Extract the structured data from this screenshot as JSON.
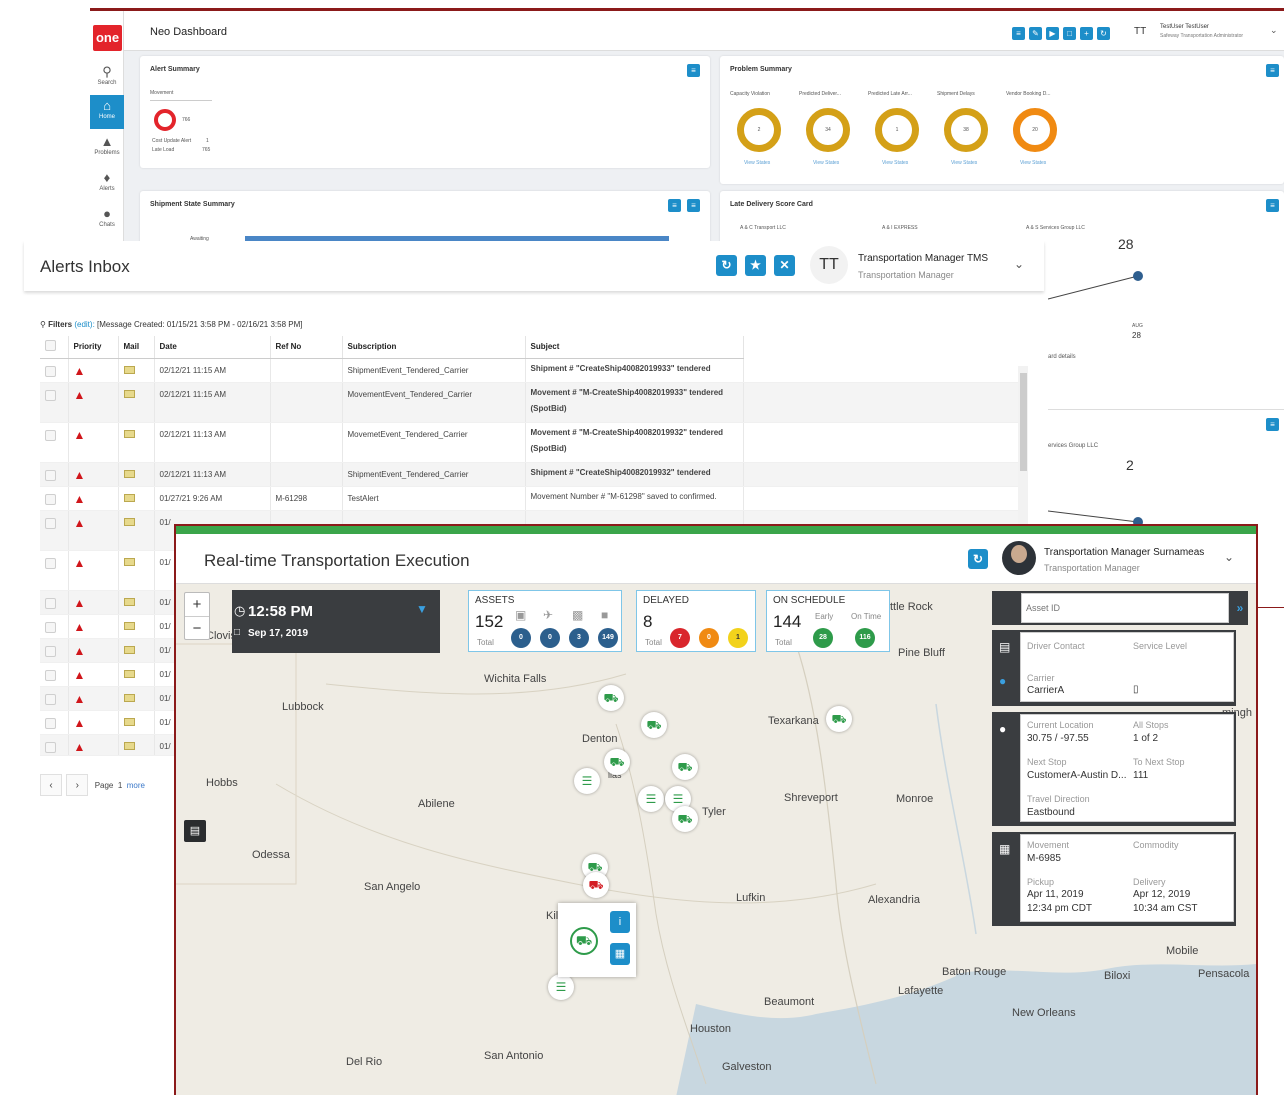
{
  "dashboard": {
    "title": "Neo Dashboard",
    "logo": "one",
    "nav": [
      {
        "label": "Search",
        "icon": "search-icon"
      },
      {
        "label": "Home",
        "icon": "home-icon"
      },
      {
        "label": "Problems",
        "icon": "warning-icon"
      },
      {
        "label": "Alerts",
        "icon": "bell-icon"
      },
      {
        "label": "Chats",
        "icon": "chat-icon"
      }
    ],
    "user": {
      "initials": "TT",
      "name": "TestUser TestUser",
      "role": "Safeway Transportation Administrator"
    },
    "alert_summary": {
      "title": "Alert Summary",
      "tab": "Movement",
      "count": "766",
      "rows": [
        {
          "label": "Cost Update Alert",
          "value": "1"
        },
        {
          "label": "Late Load",
          "value": "765"
        }
      ]
    },
    "problem_summary": {
      "title": "Problem Summary",
      "items": [
        {
          "label": "Capacity Violation",
          "value": "2",
          "link": "View States"
        },
        {
          "label": "Predicted Deliver...",
          "value": "34",
          "link": "View States"
        },
        {
          "label": "Predicted Late Arr...",
          "value": "1",
          "link": "View States"
        },
        {
          "label": "Shipment Delays",
          "value": "38",
          "link": "View States"
        },
        {
          "label": "Vendor Booking D...",
          "value": "20",
          "link": "View States"
        }
      ]
    },
    "shipment_state": {
      "title": "Shipment State Summary",
      "row_label": "Awaiting"
    },
    "late_delivery": {
      "title": "Late Delivery Score Card",
      "carriers": [
        "A & C Transport LLC",
        "A & I EXPRESS",
        "A & S Services Group LLC"
      ]
    },
    "remnant": {
      "score1": "28",
      "axis_month": "AUG",
      "axis_value": "28",
      "card_details": "ard details",
      "services_group": "ervices Group LLC",
      "score2": "2"
    }
  },
  "alerts": {
    "title": "Alerts Inbox",
    "user": {
      "initials": "TT",
      "name": "Transportation Manager TMS",
      "role": "Transportation Manager"
    },
    "filters_label": "Filters",
    "filters_edit": "(edit):",
    "filters_value": "[Message Created: 01/15/21 3:58 PM - 02/16/21 3:58 PM]",
    "columns": [
      "Priority",
      "Mail",
      "Date",
      "Ref No",
      "Subscription",
      "Subject"
    ],
    "rows": [
      {
        "date": "02/12/21 11:15 AM",
        "ref": "",
        "subscription": "ShipmentEvent_Tendered_Carrier",
        "subject": "Shipment # \"CreateShip40082019933\" tendered",
        "subject_bold": true,
        "sub_link": true
      },
      {
        "date": "02/12/21 11:15 AM",
        "ref": "",
        "subscription": "MovementEvent_Tendered_Carrier",
        "subject": "Movement # \"M-CreateShip40082019933\" tendered (SpotBid)",
        "subject_bold": true,
        "sub_link": true
      },
      {
        "date": "02/12/21 11:13 AM",
        "ref": "",
        "subscription": "MovemetEvent_Tendered_Carrier",
        "subject": "Movement # \"M-CreateShip40082019932\" tendered (SpotBid)",
        "subject_bold": true,
        "sub_link": true
      },
      {
        "date": "02/12/21 11:13 AM",
        "ref": "",
        "subscription": "ShipmentEvent_Tendered_Carrier",
        "subject": "Shipment # \"CreateShip40082019932\" tendered",
        "subject_bold": true,
        "sub_link": true
      },
      {
        "date": "01/27/21 9:26 AM",
        "ref": "M-61298",
        "subscription": "TestAlert",
        "subject": "Movement Number # \"M-61298\" saved to confirmed.",
        "subject_bold": false,
        "sub_link": false
      },
      {
        "date": "01/",
        "ref": "",
        "subscription": "",
        "subject": "",
        "subject_bold": false,
        "sub_link": false
      },
      {
        "date": "01/",
        "ref": "",
        "subscription": "",
        "subject": "",
        "subject_bold": false,
        "sub_link": false
      },
      {
        "date": "01/",
        "ref": "",
        "subscription": "",
        "subject": "",
        "subject_bold": false,
        "sub_link": false
      },
      {
        "date": "01/",
        "ref": "",
        "subscription": "",
        "subject": "",
        "subject_bold": false,
        "sub_link": false
      },
      {
        "date": "01/",
        "ref": "",
        "subscription": "",
        "subject": "",
        "subject_bold": false,
        "sub_link": false
      },
      {
        "date": "01/",
        "ref": "",
        "subscription": "",
        "subject": "",
        "subject_bold": false,
        "sub_link": false
      },
      {
        "date": "01/",
        "ref": "",
        "subscription": "",
        "subject": "",
        "subject_bold": false,
        "sub_link": false
      },
      {
        "date": "01/",
        "ref": "",
        "subscription": "",
        "subject": "",
        "subject_bold": false,
        "sub_link": false
      },
      {
        "date": "01/",
        "ref": "",
        "subscription": "",
        "subject": "",
        "subject_bold": false,
        "sub_link": false
      }
    ],
    "pager": {
      "page_label": "Page",
      "page": "1",
      "more": "more"
    }
  },
  "rte": {
    "title": "Real-time Transportation Execution",
    "user": {
      "name": "Transportation Manager Surnameas",
      "role": "Transportation Manager"
    },
    "clock": {
      "time": "12:58 PM",
      "date": "Sep 17, 2019"
    },
    "assets": {
      "label": "ASSETS",
      "total": "152",
      "total_label": "Total",
      "counts": [
        "0",
        "0",
        "3",
        "149"
      ]
    },
    "delayed": {
      "label": "DELAYED",
      "total": "8",
      "total_label": "Total",
      "counts": [
        "7",
        "0",
        "1"
      ]
    },
    "on_schedule": {
      "label": "ON SCHEDULE",
      "total": "144",
      "total_label": "Total",
      "early_label": "Early",
      "ontime_label": "On Time",
      "early": "28",
      "ontime": "116"
    },
    "cities": [
      {
        "name": "Clovis"
      },
      {
        "name": "Wichita Falls"
      },
      {
        "name": "Lubbock"
      },
      {
        "name": "Denton"
      },
      {
        "name": "Texarkana"
      },
      {
        "name": "Hobbs"
      },
      {
        "name": "Abilene"
      },
      {
        "name": "Shreveport"
      },
      {
        "name": "Monroe"
      },
      {
        "name": "Tyler"
      },
      {
        "name": "Odessa"
      },
      {
        "name": "San Angelo"
      },
      {
        "name": "Lufkin"
      },
      {
        "name": "Alexandria"
      },
      {
        "name": "Kil"
      },
      {
        "name": "Baton Rouge"
      },
      {
        "name": "Mobile"
      },
      {
        "name": "Biloxi"
      },
      {
        "name": "Pensacola"
      },
      {
        "name": "Lafayette"
      },
      {
        "name": "Beaumont"
      },
      {
        "name": "New Orleans"
      },
      {
        "name": "Houston"
      },
      {
        "name": "San Antonio"
      },
      {
        "name": "Del Rio"
      },
      {
        "name": "Galveston"
      },
      {
        "name": "Pine Bluff"
      },
      {
        "name": "ttle Rock"
      },
      {
        "name": "llas"
      },
      {
        "name": "mingh"
      }
    ],
    "asset_id_placeholder": "Asset ID",
    "driver": {
      "contact_label": "Driver Contact",
      "service_label": "Service Level",
      "carrier_label": "Carrier",
      "carrier": "CarrierA"
    },
    "location": {
      "current_label": "Current Location",
      "current": "30.75 / -97.55",
      "stops_label": "All Stops",
      "stops": "1 of 2",
      "next_label": "Next Stop",
      "next": "CustomerA-Austin D...",
      "tonext_label": "To Next Stop",
      "tonext": "111",
      "direction_label": "Travel Direction",
      "direction": "Eastbound"
    },
    "movement": {
      "movement_label": "Movement",
      "movement": "M-6985",
      "commodity_label": "Commodity",
      "pickup_label": "Pickup",
      "pickup_date": "Apr 11, 2019",
      "pickup_time": "12:34 pm CDT",
      "delivery_label": "Delivery",
      "delivery_date": "Apr 12, 2019",
      "delivery_time": "10:34 am CST"
    }
  },
  "colors": {
    "accent": "#1d8ec9",
    "brand_red": "#e3242b",
    "green": "#3aa54a",
    "frame": "#8b1a1a"
  }
}
